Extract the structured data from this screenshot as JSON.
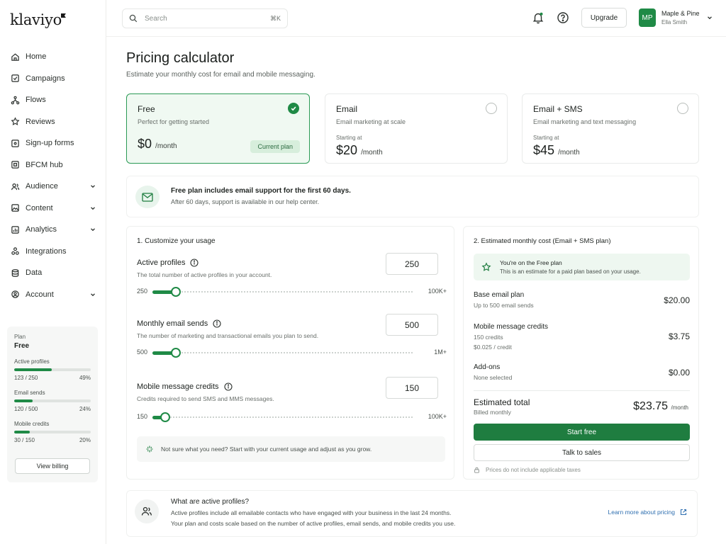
{
  "app": {
    "logo": "klaviyo"
  },
  "colors": {
    "accent": "#1f8a46",
    "accent_dark": "#1f7d40",
    "selected_bg": "#f0f9f2",
    "link": "#2f6fb0"
  },
  "sidebar": {
    "items": [
      {
        "label": "Home",
        "icon": "home-icon"
      },
      {
        "label": "Campaigns",
        "icon": "campaigns-icon"
      },
      {
        "label": "Flows",
        "icon": "flows-icon"
      },
      {
        "label": "Reviews",
        "icon": "star-icon"
      },
      {
        "label": "Sign-up forms",
        "icon": "form-icon"
      },
      {
        "label": "BFCM hub",
        "icon": "bfcm-icon"
      },
      {
        "label": "Audience",
        "icon": "audience-icon",
        "expandable": true
      },
      {
        "label": "Content",
        "icon": "content-icon",
        "expandable": true
      },
      {
        "label": "Analytics",
        "icon": "analytics-icon",
        "expandable": true
      },
      {
        "label": "Integrations",
        "icon": "integrations-icon"
      },
      {
        "label": "Data",
        "icon": "database-icon"
      },
      {
        "label": "Account",
        "icon": "account-icon",
        "expandable": true
      }
    ],
    "plan": {
      "label": "Plan",
      "name": "Free",
      "usage": [
        {
          "label": "Active profiles",
          "value": "123 / 250",
          "percent": "49%",
          "fraction": 0.49
        },
        {
          "label": "Email sends",
          "value": "120 / 500",
          "percent": "24%",
          "fraction": 0.24
        },
        {
          "label": "Mobile credits",
          "value": "30 / 150",
          "percent": "20%",
          "fraction": 0.2
        }
      ],
      "button": "View billing"
    }
  },
  "topbar": {
    "search_placeholder": "Search",
    "search_shortcut": "⌘K",
    "upgrade": "Upgrade",
    "avatar_initials": "MP",
    "account_name": "Maple & Pine",
    "user_name": "Ella Smith"
  },
  "page": {
    "title": "Pricing calculator",
    "subtitle": "Estimate your monthly cost for email and mobile messaging."
  },
  "plans": [
    {
      "name": "Free",
      "desc": "Perfect for getting started",
      "starting": "",
      "price": "$0",
      "per": "/month",
      "selected": true,
      "badge": "Current plan"
    },
    {
      "name": "Email",
      "desc": "Email marketing at scale",
      "starting": "Starting at",
      "price": "$20",
      "per": "/month",
      "selected": false
    },
    {
      "name": "Email + SMS",
      "desc": "Email marketing and text messaging",
      "starting": "Starting at",
      "price": "$45",
      "per": "/month",
      "selected": false
    }
  ],
  "banner": {
    "title": "Free plan includes email support for the first 60 days.",
    "text": "After 60 days, support is available in our help center."
  },
  "customize": {
    "heading": "1. Customize your usage",
    "fields": [
      {
        "label": "Active profiles",
        "desc": "The total number of active profiles in your account.",
        "value": "250",
        "min": "250",
        "max": "100K+",
        "fraction": 0.09
      },
      {
        "label": "Monthly email sends",
        "desc": "The number of marketing and transactional emails you plan to send.",
        "value": "500",
        "min": "500",
        "max": "1M+",
        "fraction": 0.09
      },
      {
        "label": "Mobile message credits",
        "desc": "Credits required to send SMS and MMS messages.",
        "value": "150",
        "min": "150",
        "max": "100K+",
        "fraction": 0.05
      }
    ],
    "tip": "Not sure what you need? Start with your current usage and adjust as you grow."
  },
  "cost": {
    "heading": "2. Estimated monthly cost (Email + SMS plan)",
    "note_title": "You're on the Free plan",
    "note_text": "This is an estimate for a paid plan based on your usage.",
    "lines": [
      {
        "title": "Base email plan",
        "sub": "Up to 500 email sends",
        "sub2": "",
        "amount": "$20.00"
      },
      {
        "title": "Mobile message credits",
        "sub": "150 credits",
        "sub2": "$0.025 / credit",
        "amount": "$3.75"
      },
      {
        "title": "Add-ons",
        "sub": "None selected",
        "sub2": "",
        "amount": "$0.00"
      }
    ],
    "total_title": "Estimated total",
    "total_sub": "Billed monthly",
    "total_amount": "$23.75",
    "total_per": "/month",
    "primary_button": "Start free",
    "secondary_button": "Talk to sales",
    "disclaimer": "Prices do not include applicable taxes"
  },
  "info": {
    "title": "What are active profiles?",
    "text1": "Active profiles include all emailable contacts who have engaged with your business in the last 24 months.",
    "text2": "Your plan and costs scale based on the number of active profiles, email sends, and mobile credits you use.",
    "link": "Learn more about pricing"
  }
}
